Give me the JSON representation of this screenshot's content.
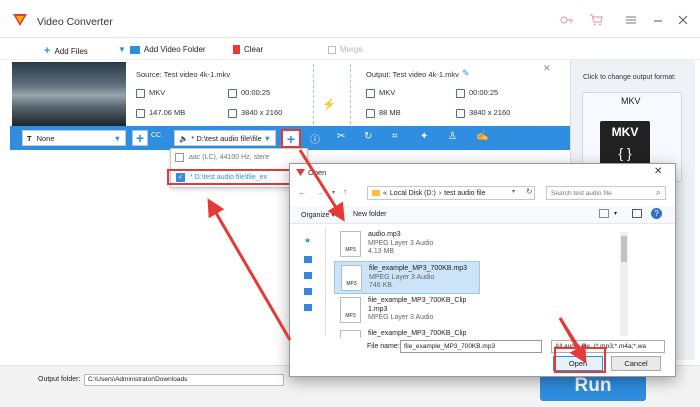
{
  "app": {
    "title": "Video Converter"
  },
  "toolbar": {
    "add_files": "Add Files",
    "add_video_folder": "Add Video Folder",
    "clear": "Clear",
    "merge": "Merge"
  },
  "file": {
    "source_label": "Source: Test video 4k-1.mkv",
    "output_label": "Output: Test video 4k-1.mkv",
    "source": {
      "format": "MKV",
      "duration": "00:00:25",
      "size": "147.06 MB",
      "resolution": "3840 x 2160"
    },
    "output": {
      "format": "MKV",
      "duration": "00:00:25",
      "size": "88 MB",
      "resolution": "3840 x 2160"
    }
  },
  "editbar": {
    "subtitle_select": "None",
    "audio_select": "* D:\\test audio file\\file"
  },
  "audio_dropdown": {
    "items": [
      {
        "label": "aac (LC), 44100 Hz, stere",
        "checked": false
      },
      {
        "label": "* D:\\test audio file\\file_ex",
        "checked": true
      }
    ]
  },
  "output_format": {
    "hint": "Click to change output format:",
    "format": "MKV",
    "badge": "MKV"
  },
  "bottom": {
    "output_folder_label": "Output folder:",
    "output_folder_value": "C:\\Users\\Administrator\\Downloads",
    "run_label": "Run"
  },
  "dialog": {
    "title": "Open",
    "breadcrumb": [
      "Local Disk (D:)",
      "test audio file"
    ],
    "search_placeholder": "Search test audio file",
    "organize": "Organize",
    "new_folder": "New folder",
    "files": [
      {
        "name": "audio.mp3",
        "type": "MPEG Layer 3 Audio",
        "size": "4.13 MB",
        "selected": false
      },
      {
        "name": "file_example_MP3_700KB.mp3",
        "type": "MPEG Layer 3 Audio",
        "size": "746 KB",
        "selected": true
      },
      {
        "name": "file_example_MP3_700KB_Clip",
        "name2": "1.mp3",
        "type": "MPEG Layer 3 Audio",
        "selected": false
      },
      {
        "name": "file_example_MP3_700KB_Clip",
        "selected": false
      }
    ],
    "file_name_label": "File name:",
    "file_name_value": "file_example_MP3_700KB.mp3",
    "file_type_value": "All audio file. (*.mp3;*.m4a;*.wa",
    "open_label": "Open",
    "cancel_label": "Cancel"
  },
  "colors": {
    "accent": "#2f8ee0",
    "highlight": "#e53935"
  }
}
